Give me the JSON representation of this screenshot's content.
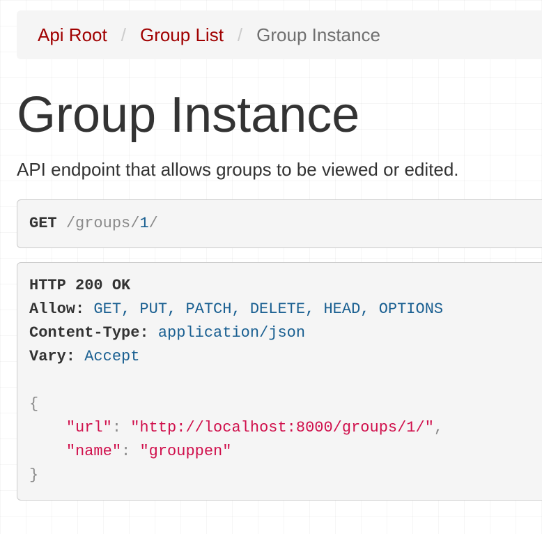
{
  "breadcrumb": {
    "items": [
      {
        "label": "Api Root"
      },
      {
        "label": "Group List"
      },
      {
        "label": "Group Instance"
      }
    ],
    "separator": "/"
  },
  "page": {
    "title": "Group Instance",
    "description": "API endpoint that allows groups to be viewed or edited."
  },
  "request": {
    "method": "GET",
    "path_segments": [
      "/groups/",
      "1",
      "/"
    ]
  },
  "response": {
    "status": "HTTP 200 OK",
    "headers": [
      {
        "name": "Allow:",
        "value": "GET, PUT, PATCH, DELETE, HEAD, OPTIONS"
      },
      {
        "name": "Content-Type:",
        "value": "application/json"
      },
      {
        "name": "Vary:",
        "value": "Accept"
      }
    ],
    "body": {
      "open_brace": "{",
      "close_brace": "}",
      "fields": [
        {
          "key": "\"url\"",
          "colon": ":",
          "value": "\"http://localhost:8000/groups/1/\"",
          "comma": ","
        },
        {
          "key": "\"name\"",
          "colon": ":",
          "value": "\"grouppen\"",
          "comma": ""
        }
      ]
    }
  },
  "colors": {
    "link": "#a00000",
    "active_crumb": "#6f6f6f",
    "code_background": "#f5f5f5",
    "header_value": "#195f91",
    "json_string": "#d0104c"
  }
}
